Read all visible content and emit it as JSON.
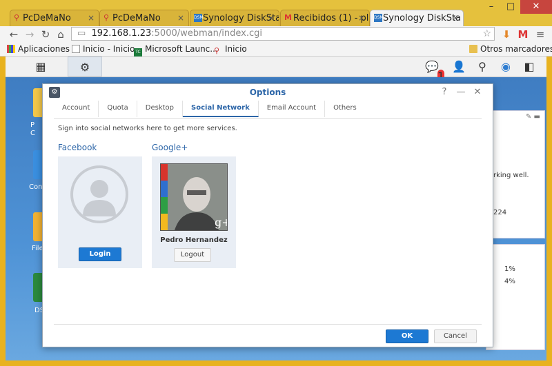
{
  "browser": {
    "tabs": [
      {
        "title": "PcDeMaNo",
        "favicon": "pcdemano-icon"
      },
      {
        "title": "PcDeMaNo",
        "favicon": "pcdemano-icon"
      },
      {
        "title": "Synology DiskSta",
        "favicon": "dsm-icon"
      },
      {
        "title": "Recibidos (1) - pl",
        "favicon": "gmail-icon"
      },
      {
        "title": "Synology DiskSta",
        "favicon": "dsm-icon"
      }
    ],
    "url_host": "192.168.1.23",
    "url_path": ":5000/webman/index.cgi",
    "bookmarks": [
      "Aplicaciones",
      "Inicio - Inicio",
      "Microsoft Launc...",
      "Inicio"
    ],
    "other_bookmarks": "Otros marcadores"
  },
  "dsm": {
    "notification_count": "1",
    "desktop_labels": [
      "P",
      "C",
      "Con",
      "File",
      "DS"
    ],
    "widget_text": [
      "rking well.",
      "224",
      "1%",
      "4%"
    ]
  },
  "dialog": {
    "title": "Options",
    "tabs": [
      "Account",
      "Quota",
      "Desktop",
      "Social Network",
      "Email Account",
      "Others"
    ],
    "active_tab": "Social Network",
    "intro": "Sign into social networks here to get more services.",
    "facebook": {
      "heading": "Facebook",
      "login_label": "Login"
    },
    "google": {
      "heading": "Google+",
      "user_name": "Pedro Hernandez",
      "logout_label": "Logout"
    },
    "ok_label": "OK",
    "cancel_label": "Cancel"
  },
  "colors": {
    "accent": "#2d66a8",
    "primary_button": "#1d79d3",
    "card_bg": "#e9eef5"
  }
}
